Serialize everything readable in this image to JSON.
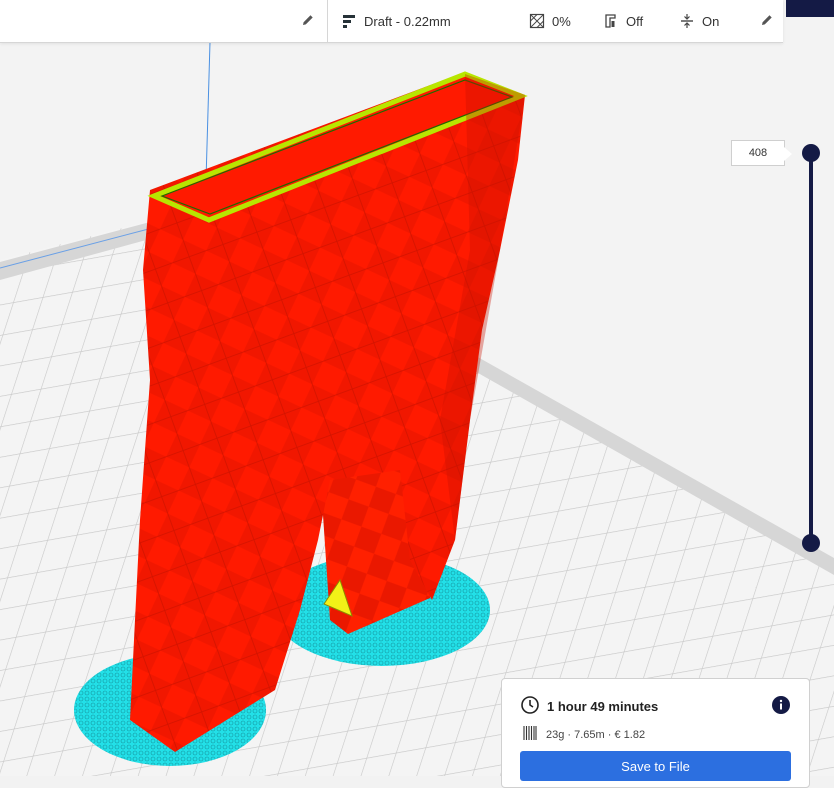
{
  "toolbar": {
    "profile": "Draft - 0.22mm",
    "infill": "0%",
    "support": "Off",
    "adhesion": "On"
  },
  "layer_slider": {
    "current_layer": "408"
  },
  "print_info": {
    "time": "1 hour 49 minutes",
    "material": "23g · 7.65m · € 1.82",
    "save_label": "Save to File"
  },
  "colors": {
    "accent": "#2c6fe0",
    "dark": "#141a45",
    "wall": "#ff1a00",
    "skirt": "#22e0e8",
    "top_skin": "#b8e600"
  },
  "icons": [
    "edit-icon",
    "profile-icon",
    "infill-icon",
    "support-icon",
    "adhesion-icon",
    "clock-icon",
    "info-icon",
    "spool-icon"
  ]
}
